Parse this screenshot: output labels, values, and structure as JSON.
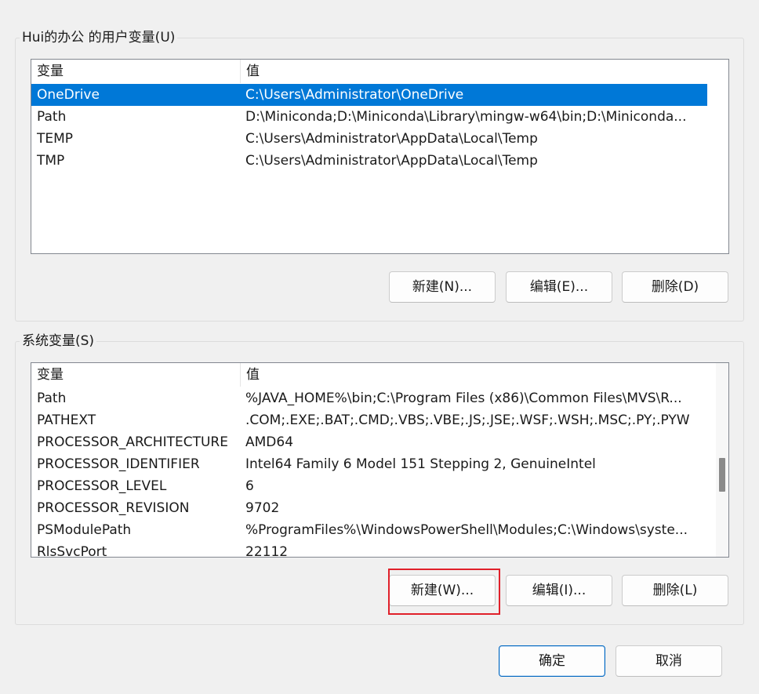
{
  "user_vars": {
    "title": "Hui的办公 的用户变量(U)",
    "col_variable": "变量",
    "col_value": "值",
    "rows": [
      {
        "name": "OneDrive",
        "value": "C:\\Users\\Administrator\\OneDrive",
        "selected": true
      },
      {
        "name": "Path",
        "value": "D:\\Miniconda;D:\\Miniconda\\Library\\mingw-w64\\bin;D:\\Miniconda...",
        "selected": false
      },
      {
        "name": "TEMP",
        "value": "C:\\Users\\Administrator\\AppData\\Local\\Temp",
        "selected": false
      },
      {
        "name": "TMP",
        "value": "C:\\Users\\Administrator\\AppData\\Local\\Temp",
        "selected": false
      }
    ],
    "buttons": {
      "new": "新建(N)...",
      "edit": "编辑(E)...",
      "delete": "删除(D)"
    }
  },
  "system_vars": {
    "title": "系统变量(S)",
    "col_variable": "变量",
    "col_value": "值",
    "rows": [
      {
        "name": "Path",
        "value": "%JAVA_HOME%\\bin;C:\\Program Files (x86)\\Common Files\\MVS\\R..."
      },
      {
        "name": "PATHEXT",
        "value": ".COM;.EXE;.BAT;.CMD;.VBS;.VBE;.JS;.JSE;.WSF;.WSH;.MSC;.PY;.PYW"
      },
      {
        "name": "PROCESSOR_ARCHITECTURE",
        "value": "AMD64"
      },
      {
        "name": "PROCESSOR_IDENTIFIER",
        "value": "Intel64 Family 6 Model 151 Stepping 2, GenuineIntel"
      },
      {
        "name": "PROCESSOR_LEVEL",
        "value": "6"
      },
      {
        "name": "PROCESSOR_REVISION",
        "value": "9702"
      },
      {
        "name": "PSModulePath",
        "value": "%ProgramFiles%\\WindowsPowerShell\\Modules;C:\\Windows\\syste..."
      },
      {
        "name": "RlsSvcPort",
        "value": "22112"
      }
    ],
    "buttons": {
      "new": "新建(W)...",
      "edit": "编辑(I)...",
      "delete": "删除(L)"
    }
  },
  "dialog_buttons": {
    "ok": "确定",
    "cancel": "取消"
  },
  "colors": {
    "selection": "#0078d7",
    "highlight_outline": "#e0202a",
    "default_button_border": "#0067c0"
  }
}
